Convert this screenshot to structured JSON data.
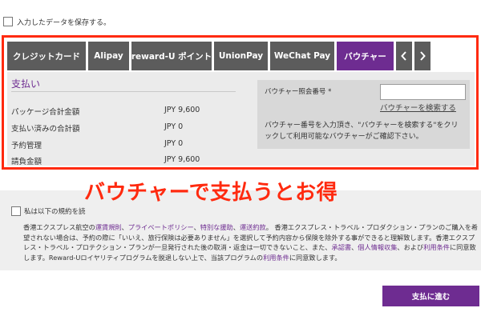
{
  "save_data": {
    "label": "入力したデータを保存する。",
    "checked": false
  },
  "tabs": [
    {
      "label": "クレジットカード",
      "active": false
    },
    {
      "label": "Alipay",
      "active": false
    },
    {
      "label": "reward-U ポイント",
      "active": false
    },
    {
      "label": "UnionPay",
      "active": false
    },
    {
      "label": "WeChat Pay",
      "active": false
    },
    {
      "label": "バウチャー",
      "active": true
    }
  ],
  "tab_nav": {
    "prev_icon": "chevron-left-icon",
    "next_icon": "chevron-right-icon"
  },
  "payment": {
    "title": "支払い",
    "rows": [
      {
        "label": "パッケージ合計金額",
        "value": "JPY 9,600"
      },
      {
        "label": "支払い済みの合計額",
        "value": "JPY 0"
      },
      {
        "label": "予約管理",
        "value": "JPY 0"
      },
      {
        "label": "請負金額",
        "value": "JPY 9,600"
      }
    ]
  },
  "voucher": {
    "label": "バウチャー照会番号 *",
    "input_value": "",
    "search_link": "バウチャーを検索する",
    "description": "バウチャー番号を入力頂き、\"バウチャーを検索する\"をクリックして利用可能なバウチャーがご確認下さい。"
  },
  "banner": {
    "text": "バウチャーで支払うとお得"
  },
  "terms": {
    "head": "私は以下の規約を読",
    "b1": "香港エクスプレス航空の",
    "l1": "運賃規則",
    "b2": "、",
    "l2": "プライベートポリシー",
    "b3": "、",
    "l3": "特別な援助",
    "b4": "、",
    "l4": "運送約款",
    "b5": "。 香港エクスプレス・トラベル・プロダクション・プランのご購入を希望されない場合は、予約の際に「いいえ、旅行保険は必要ありません」を選択して予約内容から保険を除外する事ができると理解致します。香港エクスプレス・トラベル・プロテクション・プランが一旦発行された後の取消・返金は一切できないこと、また、",
    "l5": "承認書",
    "b6": "、",
    "l6": "個人情報収集",
    "b7": "、および",
    "l7": "利用条件",
    "b8": "に同意致します。Reward-Uロイヤリティプログラムを脱退しない上で、当該プログラムの",
    "l8": "利用条件",
    "b9": "に同意致します。"
  },
  "proceed_button": {
    "label": "支払に進む"
  },
  "colors": {
    "accent": "#6e2c91",
    "highlight": "#ff2a0f",
    "tab_inactive": "#5c5c5c"
  }
}
